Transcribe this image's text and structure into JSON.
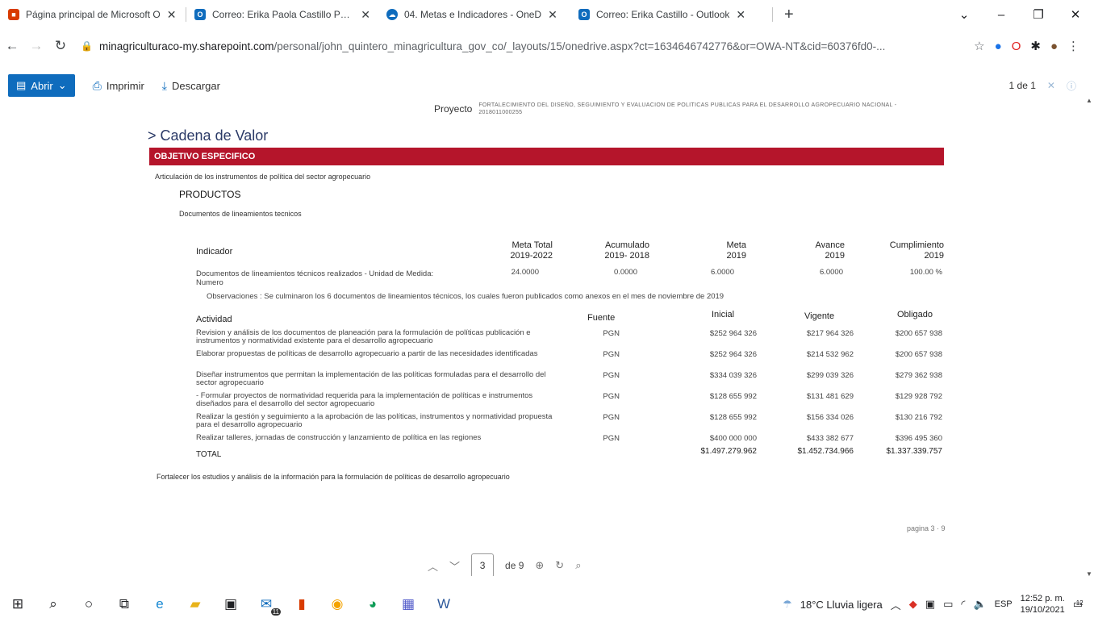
{
  "browser": {
    "tabs": [
      {
        "title": "Página principal de Microsoft O",
        "icon": "office-icon",
        "color": "#d83b01"
      },
      {
        "title": "Correo: Erika Paola Castillo Peral",
        "icon": "outlook-icon",
        "color": "#0f6cbd"
      },
      {
        "title": "04. Metas e Indicadores - OneD",
        "icon": "onedrive-icon",
        "color": "#0f6cbd"
      },
      {
        "title": "Correo: Erika Castillo - Outlook",
        "icon": "outlook-icon",
        "color": "#0f6cbd"
      }
    ],
    "url_host": "minagriculturaco-my.sharepoint.com",
    "url_path": "/personal/john_quintero_minagricultura_gov_co/_layouts/15/onedrive.aspx?ct=1634646742776&or=OWA-NT&cid=60376fd0-..."
  },
  "viewer": {
    "open_label": "Abrir",
    "print_label": "Imprimir",
    "download_label": "Descargar",
    "page_of": "1 de 1"
  },
  "doc": {
    "project_label": "Proyecto",
    "project_value": "FORTALECIMIENTO DEL DISEÑO, SEGUIMIENTO Y EVALUACION DE POLITICAS PUBLICAS PARA EL DESARROLLO AGROPECUARIO NACIONAL - 2018011000255",
    "section_title": "> Cadena de Valor",
    "objective_header": "OBJETIVO ESPECIFICO",
    "objective_text": "Articulación de los instrumentos de política del sector agropecuario",
    "products_header": "PRODUCTOS",
    "product_text": "Documentos de lineamientos tecnicos",
    "indicator": {
      "headers": {
        "indicador": "Indicador",
        "meta_total": "Meta Total\n2019-2022",
        "acumulado": "Acumulado\n2019- 2018",
        "meta": "Meta\n2019",
        "avance": "Avance\n2019",
        "cumplimiento": "Cumplimiento\n2019"
      },
      "name": "Documentos de lineamientos técnicos realizados - Unidad de Medida: Numero",
      "meta_total": "24.0000",
      "acumulado": "0.0000",
      "meta": "6.0000",
      "avance": "6.0000",
      "cumplimiento": "100.00 %"
    },
    "observaciones": "Observaciones : Se culminaron los 6 documentos de lineamientos técnicos, los cuales fueron publicados como anexos en el mes de noviembre de 2019",
    "activities": {
      "headers": {
        "actividad": "Actividad",
        "fuente": "Fuente",
        "inicial": "Inicial",
        "vigente": "Vigente",
        "obligado": "Obligado"
      },
      "rows": [
        {
          "desc": "Revision y análisis de los documentos de planeación para la formulación de políticas publicación e instrumentos y normatividad existente para el desarrollo agropecuario",
          "fuente": "PGN",
          "inicial": "$252 964 326",
          "vigente": "$217 964 326",
          "obligado": "$200 657 938"
        },
        {
          "desc": "Elaborar propuestas de políticas de desarrollo agropecuario a partir de las necesidades identificadas",
          "fuente": "PGN",
          "inicial": "$252 964 326",
          "vigente": "$214 532 962",
          "obligado": "$200 657 938"
        },
        {
          "desc": "Diseñar instrumentos que permitan la implementación de las políticas formuladas para el desarrollo del sector agropecuario",
          "fuente": "PGN",
          "inicial": "$334 039 326",
          "vigente": "$299 039 326",
          "obligado": "$279 362 938"
        },
        {
          "desc": "- Formular proyectos de normatividad requerida para la implementación de políticas e instrumentos diseñados para el desarrollo del sector agropecuario",
          "fuente": "PGN",
          "inicial": "$128 655 992",
          "vigente": "$131 481 629",
          "obligado": "$129 928 792"
        },
        {
          "desc": "Realizar la gestión y seguimiento a la aprobación de las políticas, instrumentos y normatividad propuesta para el desarrollo agropecuario",
          "fuente": "PGN",
          "inicial": "$128 655 992",
          "vigente": "$156 334 026",
          "obligado": "$130 216 792"
        },
        {
          "desc": "Realizar talleres, jornadas de construcción y lanzamiento de política en las regiones",
          "fuente": "PGN",
          "inicial": "$400 000 000",
          "vigente": "$433 382 677",
          "obligado": "$396 495 360"
        }
      ],
      "total_label": "TOTAL",
      "total_inicial": "$1.497.279.962",
      "total_vigente": "$1.452.734.966",
      "total_obligado": "$1.337.339.757"
    },
    "next_objective": "Fortalecer los estudios y análisis de la información para la formulación de políticas de desarrollo agropecuario",
    "page_footer": "pagina 3 · 9"
  },
  "pager": {
    "current": "3",
    "of_label": "de 9"
  },
  "taskbar": {
    "weather": "18°C  Lluvia ligera",
    "lang": "ESP",
    "time": "12:52 p. m.",
    "date": "19/10/2021",
    "notif_count": "12",
    "mail_badge": "11"
  }
}
